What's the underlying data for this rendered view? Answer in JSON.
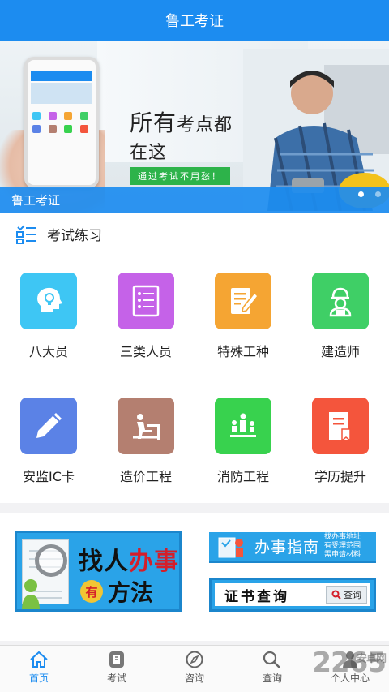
{
  "header": {
    "title": "鲁工考证"
  },
  "banner": {
    "slogan_big": "所有",
    "slogan_rest": "考点都在这",
    "slogan_sub": "通过考试不用愁！",
    "caption": "鲁工考证",
    "pages": 2,
    "active_page": 1
  },
  "exam": {
    "title": "考试练习",
    "items": [
      {
        "label": "八大员",
        "icon": "head-idea-icon",
        "color": "#3ec6f4"
      },
      {
        "label": "三类人员",
        "icon": "checklist-icon",
        "color": "#c562e8"
      },
      {
        "label": "特殊工种",
        "icon": "edit-doc-icon",
        "color": "#f5a533"
      },
      {
        "label": "建造师",
        "icon": "engineer-icon",
        "color": "#3fcf66"
      },
      {
        "label": "安监IC卡",
        "icon": "pencil-icon",
        "color": "#5b82e6"
      },
      {
        "label": "造价工程",
        "icon": "desk-person-icon",
        "color": "#b47f70"
      },
      {
        "label": "消防工程",
        "icon": "podium-icon",
        "color": "#38d24e"
      },
      {
        "label": "学历提升",
        "icon": "bookmark-doc-icon",
        "color": "#f4553c"
      }
    ]
  },
  "service": {
    "find_line1_a": "找人",
    "find_line1_b": "办事",
    "find_you": "有",
    "find_line2": "方法",
    "guide_title": "办事指南",
    "guide_sub": "找办事地址 有受理范围 需申请材料",
    "cert_title": "证书查询",
    "cert_button": "查询"
  },
  "tabbar": {
    "items": [
      {
        "label": "首页",
        "icon": "home-icon",
        "active": true
      },
      {
        "label": "考试",
        "icon": "exam-icon",
        "active": false
      },
      {
        "label": "咨询",
        "icon": "compass-icon",
        "active": false
      },
      {
        "label": "查询",
        "icon": "search-icon",
        "active": false
      },
      {
        "label": "个人中心",
        "icon": "person-icon",
        "active": false
      }
    ]
  },
  "watermark": {
    "number": "2265",
    "site": "安卓网"
  }
}
